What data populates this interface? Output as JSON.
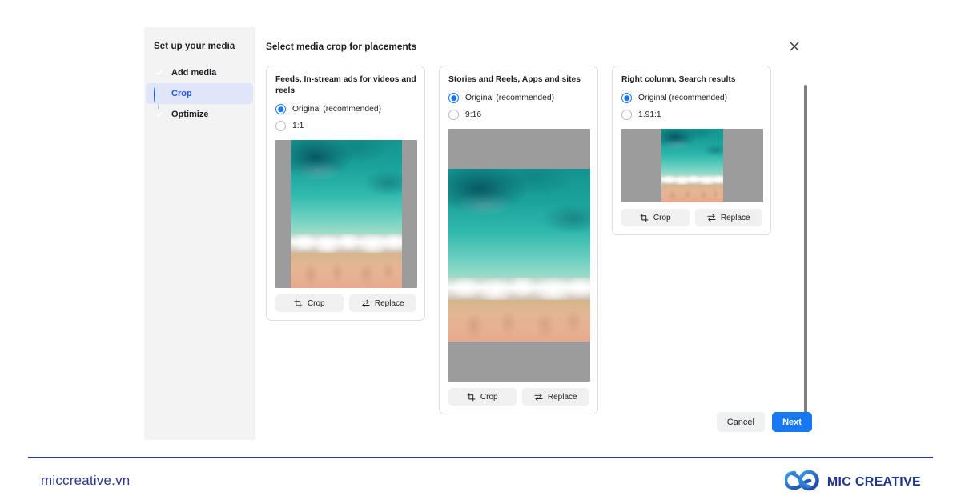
{
  "sidebar": {
    "title": "Set up your media",
    "items": [
      {
        "label": "Add media",
        "icon": "check-circle-icon",
        "state": "complete"
      },
      {
        "label": "Crop",
        "icon": "half-circle-icon",
        "state": "active"
      },
      {
        "label": "Optimize",
        "icon": "check-circle-icon",
        "state": "complete"
      }
    ]
  },
  "header": {
    "title": "Select media crop for placements",
    "close_icon": "close-icon"
  },
  "cards": [
    {
      "title": "Feeds, In-stream ads for videos and reels",
      "options": [
        {
          "label": "Original (recommended)",
          "selected": true
        },
        {
          "label": "1:1",
          "selected": false
        }
      ],
      "crop_label": "Crop",
      "replace_label": "Replace"
    },
    {
      "title": "Stories and Reels, Apps and sites",
      "options": [
        {
          "label": "Original (recommended)",
          "selected": true
        },
        {
          "label": "9:16",
          "selected": false
        }
      ],
      "crop_label": "Crop",
      "replace_label": "Replace"
    },
    {
      "title": "Right column, Search results",
      "options": [
        {
          "label": "Original (recommended)",
          "selected": true
        },
        {
          "label": "1.91:1",
          "selected": false
        }
      ],
      "crop_label": "Crop",
      "replace_label": "Replace"
    }
  ],
  "footer": {
    "cancel_label": "Cancel",
    "next_label": "Next"
  },
  "brand": {
    "url": "miccreative.vn",
    "name": "MIC CREATIVE",
    "logo_icon": "infinity-loop-icon"
  },
  "colors": {
    "accent_blue": "#1877f2",
    "active_blue": "#1f57d6",
    "complete_green": "#36c22b",
    "active_row_bg": "#dfe6fa",
    "sidebar_bg": "#f3f3f4",
    "letterbox_gray": "#9c9c9c",
    "brand_navy": "#2b3a8f"
  }
}
